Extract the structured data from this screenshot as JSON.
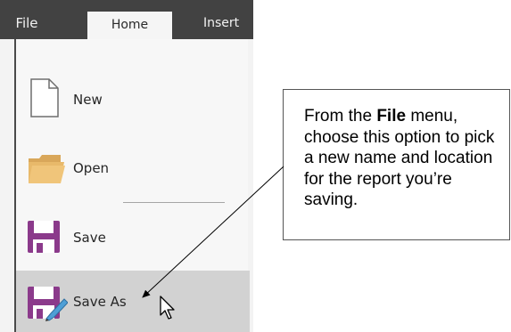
{
  "ribbon": {
    "tabs": [
      {
        "label": "File"
      },
      {
        "label": "Home"
      },
      {
        "label": "Insert"
      }
    ]
  },
  "file_menu": {
    "items": [
      {
        "label": "New",
        "icon": "new-document-icon"
      },
      {
        "label": "Open",
        "icon": "open-folder-icon"
      },
      {
        "label": "Save",
        "icon": "save-disk-icon"
      },
      {
        "label": "Save As",
        "icon": "save-as-disk-pencil-icon",
        "highlighted": true
      }
    ]
  },
  "callout": {
    "text_before": "From the ",
    "text_bold": "File",
    "text_after": " menu, choose this option to pick a new name and location for the report you’re saving."
  },
  "colors": {
    "ribbon_bg": "#424242",
    "backstage_bg": "#f7f7f7",
    "highlight_bg": "#d2d2d2",
    "save_icon": "#8b3a8b",
    "folder_icon": "#e8b96a"
  }
}
